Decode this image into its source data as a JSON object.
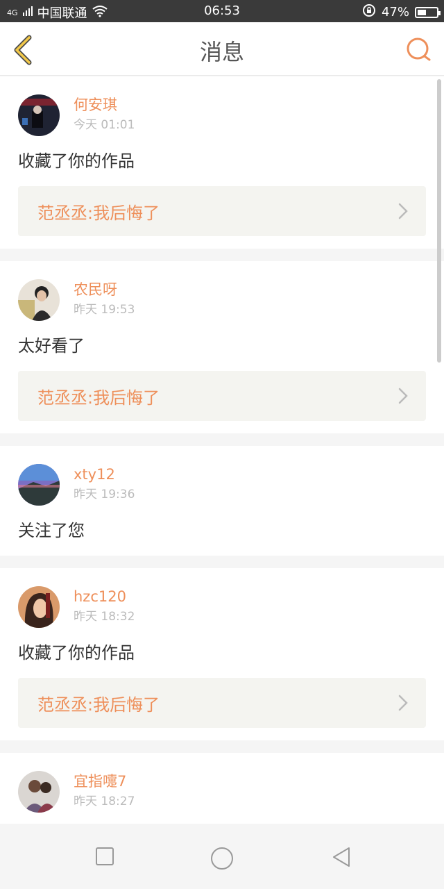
{
  "status_bar": {
    "network": "4G",
    "carrier": "中国联通",
    "time": "06:53",
    "battery": "47%",
    "battery_level": 0.47
  },
  "header": {
    "title": "消息"
  },
  "messages": [
    {
      "name": "何安琪",
      "time": "今天 01:01",
      "text": "收藏了你的作品",
      "quote": "范丞丞:我后悔了"
    },
    {
      "name": "农民呀",
      "time": "昨天 19:53",
      "text": "太好看了",
      "quote": "范丞丞:我后悔了"
    },
    {
      "name": "xty12",
      "time": "昨天 19:36",
      "text": "关注了您"
    },
    {
      "name": "hzc120",
      "time": "昨天 18:32",
      "text": "收藏了你的作品",
      "quote": "范丞丞:我后悔了"
    },
    {
      "name": "宜指嚏7",
      "time": "昨天 18:27"
    }
  ],
  "colors": {
    "accent": "#ee8f5a",
    "back_arrow": "#f3c94a",
    "status_bar_bg": "#3a3a3a"
  }
}
